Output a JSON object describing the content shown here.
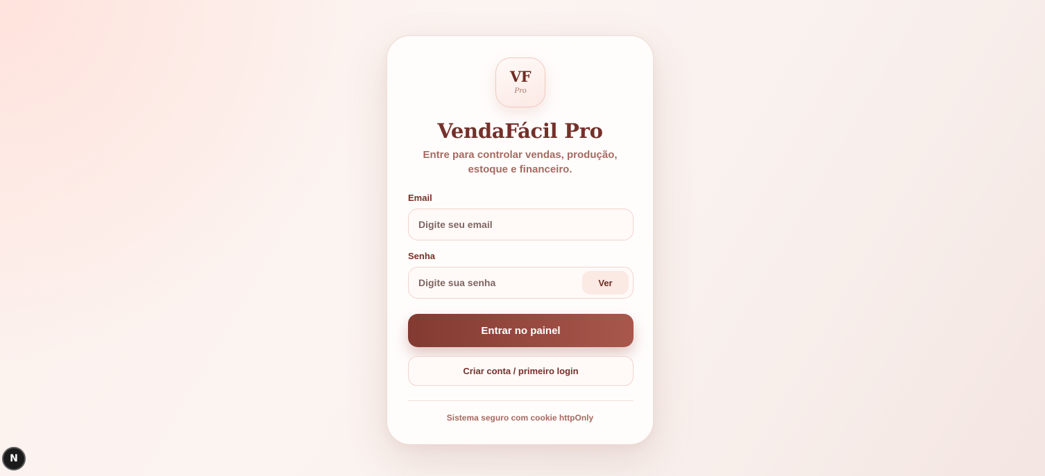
{
  "logo": {
    "main": "VF",
    "sub": "Pro"
  },
  "header": {
    "title": "VendaFácil Pro",
    "subtitle": "Entre para controlar vendas, produção, estoque e financeiro."
  },
  "form": {
    "email_label": "Email",
    "email_placeholder": "Digite seu email",
    "email_value": "",
    "password_label": "Senha",
    "password_placeholder": "Digite sua senha",
    "password_value": "",
    "show_password_label": "Ver",
    "submit_label": "Entrar no painel",
    "create_account_label": "Criar conta / primeiro login"
  },
  "footer": {
    "note": "Sistema seguro com cookie httpOnly"
  },
  "dev_badge": {
    "icon": "nextjs-icon",
    "glyph": "N"
  },
  "colors": {
    "accent": "#823a31",
    "accent_light": "#a9574c",
    "title": "#74302a",
    "muted": "#a56a60",
    "card_border": "#f1dcd6"
  }
}
